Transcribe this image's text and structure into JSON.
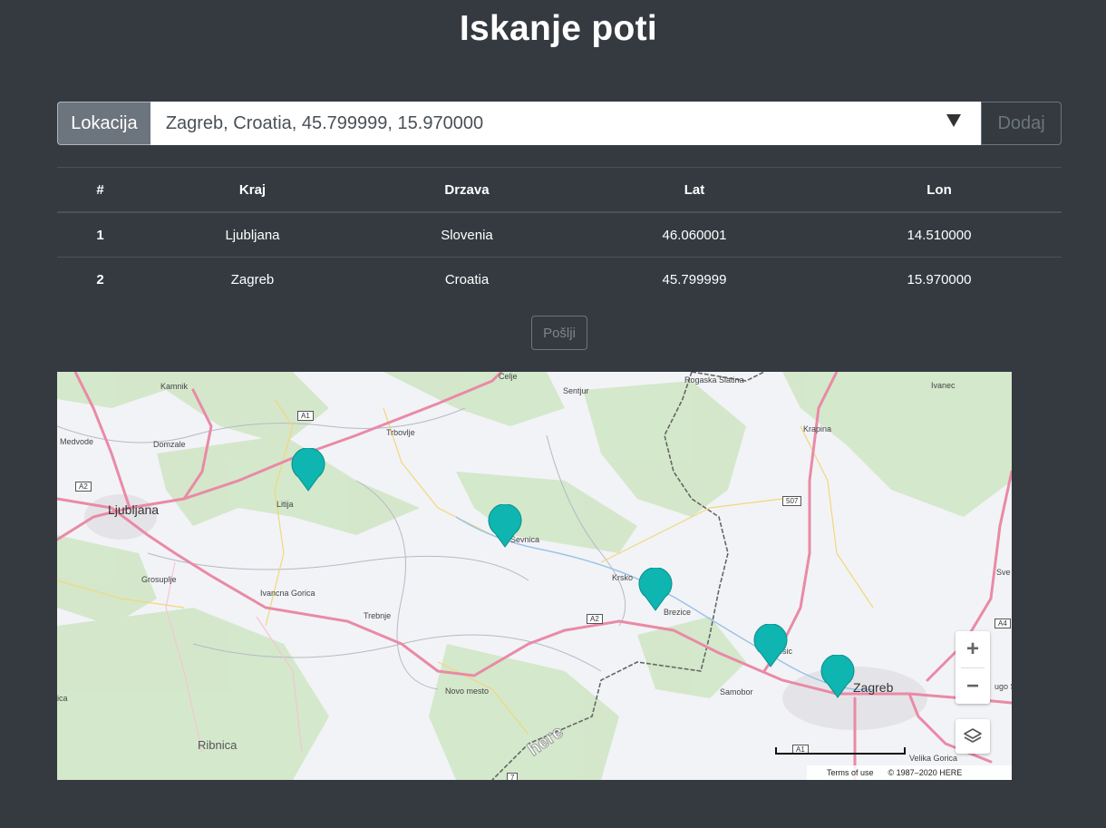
{
  "page": {
    "title": "Iskanje poti"
  },
  "form": {
    "prepend_label": "Lokacija",
    "selected_value": "Zagreb, Croatia, 45.799999, 15.970000",
    "add_label": "Dodaj"
  },
  "table": {
    "headers": [
      "#",
      "Kraj",
      "Drzava",
      "Lat",
      "Lon"
    ],
    "rows": [
      {
        "num": "1",
        "city": "Ljubljana",
        "country": "Slovenia",
        "lat": "46.060001",
        "lon": "14.510000"
      },
      {
        "num": "2",
        "city": "Zagreb",
        "country": "Croatia",
        "lat": "45.799999",
        "lon": "15.970000"
      }
    ]
  },
  "send_label": "Pošlji",
  "map": {
    "labels": {
      "ljubljana": "Ljubljana",
      "zagreb": "Zagreb",
      "ribnica": "Ribnica",
      "celje": "Celje",
      "sentjur": "Sentjur",
      "rogaska": "Rogaska Slatina",
      "ivanec": "Ivanec",
      "kamnik": "Kamnik",
      "medvode": "Medvode",
      "domzale": "Domzale",
      "trbovlje": "Trbovlje",
      "krapina": "Krapina",
      "litija": "Litija",
      "sevnica": "Sevnica",
      "grosuplje": "Grosuplje",
      "ivancna": "Ivancna Gorica",
      "trebnje": "Trebnje",
      "krsko": "Krsko",
      "brezice": "Brezice",
      "zapresic": "esic",
      "samobor": "Samobor",
      "novo_mesto": "Novo mesto",
      "velika_gorica": "Velika Gorica",
      "sveti": "Sve",
      "dugo": "ugo Se",
      "edge_left": "ica"
    },
    "shields": {
      "a1_top": "A1",
      "a2_left": "A2",
      "a2_mid": "A2",
      "r507": "507",
      "a4": "A4",
      "a1_bottom": "A1",
      "r7": "7"
    },
    "marker_color": "#0fb5b0",
    "marker_count": 5,
    "zoom_in": "+",
    "zoom_out": "−",
    "terms": "Terms of use",
    "copyright": "© 1987–2020 HERE",
    "logo_text": "here"
  }
}
